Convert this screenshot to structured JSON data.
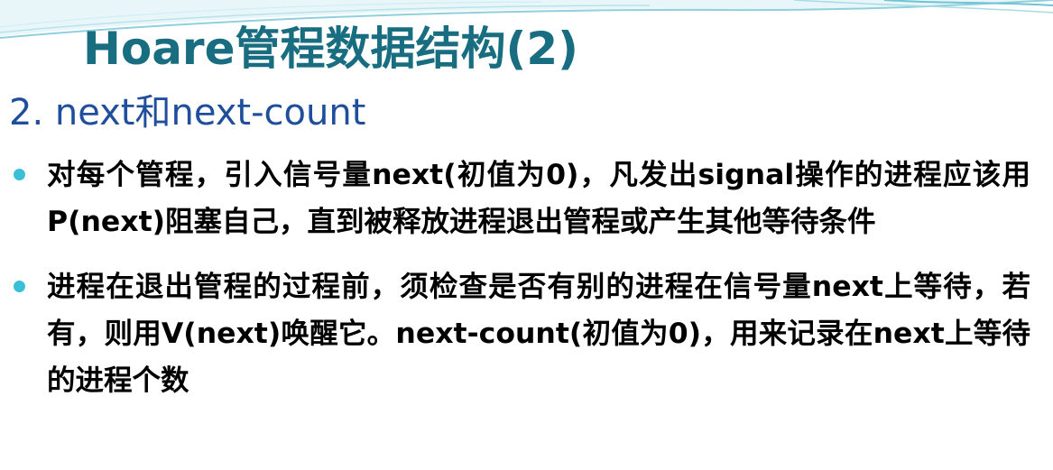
{
  "slide": {
    "title": "Hoare管程数据结构(2)",
    "subtitle": "2. next和next-count",
    "bullets": [
      "对每个管程，引入信号量next(初值为0)，凡发出signal操作的进程应该用P(next)阻塞自己，直到被释放进程退出管程或产生其他等待条件",
      "进程在退出管程的过程前，须检查是否有别的进程在信号量next上等待，若有，则用V(next)唤醒它。next-count(初值为0)，用来记录在next上等待的进程个数"
    ]
  },
  "colors": {
    "title": "#186e80",
    "subtitle": "#1f4e9c",
    "bullet_dot": "#3ac0d6",
    "decor_wave": "#9fd9e2"
  }
}
